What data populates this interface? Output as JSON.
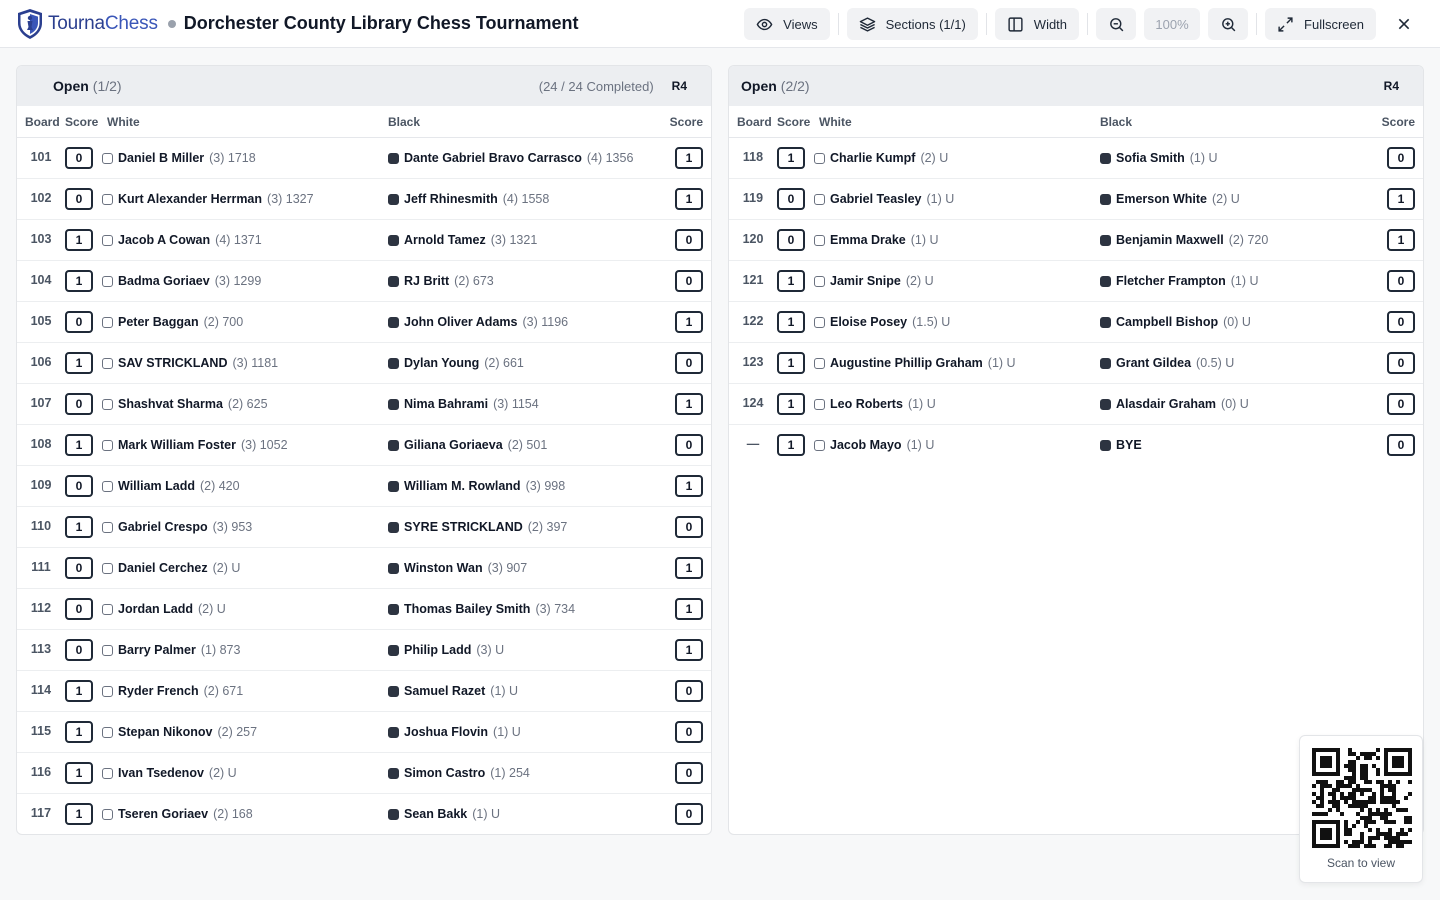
{
  "app": {
    "logo_text_a": "Tourna",
    "logo_text_b": "Chess",
    "title": "Dorchester County Library Chess Tournament"
  },
  "toolbar": {
    "views": "Views",
    "sections": "Sections (1/1)",
    "width": "Width",
    "zoom": "100%",
    "fullscreen": "Fullscreen"
  },
  "columns": {
    "board": "Board",
    "score": "Score",
    "white": "White",
    "black": "Black",
    "score_right": "Score"
  },
  "sections": [
    {
      "name": "Open",
      "count": "(1/2)",
      "completed": "(24 / 24 Completed)",
      "round": "R4",
      "rows": [
        {
          "board": "101",
          "ws": "0",
          "wn": "Daniel B Miller",
          "wm": "(3) 1718",
          "bn": "Dante Gabriel Bravo Carrasco",
          "bm": "(4) 1356",
          "bs": "1"
        },
        {
          "board": "102",
          "ws": "0",
          "wn": "Kurt Alexander Herrman",
          "wm": "(3) 1327",
          "bn": "Jeff Rhinesmith",
          "bm": "(4) 1558",
          "bs": "1"
        },
        {
          "board": "103",
          "ws": "1",
          "wn": "Jacob A Cowan",
          "wm": "(4) 1371",
          "bn": "Arnold Tamez",
          "bm": "(3) 1321",
          "bs": "0"
        },
        {
          "board": "104",
          "ws": "1",
          "wn": "Badma Goriaev",
          "wm": "(3) 1299",
          "bn": "RJ Britt",
          "bm": "(2) 673",
          "bs": "0"
        },
        {
          "board": "105",
          "ws": "0",
          "wn": "Peter Baggan",
          "wm": "(2) 700",
          "bn": "John Oliver Adams",
          "bm": "(3) 1196",
          "bs": "1"
        },
        {
          "board": "106",
          "ws": "1",
          "wn": "SAV STRICKLAND",
          "wm": "(3) 1181",
          "bn": "Dylan Young",
          "bm": "(2) 661",
          "bs": "0"
        },
        {
          "board": "107",
          "ws": "0",
          "wn": "Shashvat Sharma",
          "wm": "(2) 625",
          "bn": "Nima Bahrami",
          "bm": "(3) 1154",
          "bs": "1"
        },
        {
          "board": "108",
          "ws": "1",
          "wn": "Mark William Foster",
          "wm": "(3) 1052",
          "bn": "Giliana Goriaeva",
          "bm": "(2) 501",
          "bs": "0"
        },
        {
          "board": "109",
          "ws": "0",
          "wn": "William Ladd",
          "wm": "(2) 420",
          "bn": "William M. Rowland",
          "bm": "(3) 998",
          "bs": "1"
        },
        {
          "board": "110",
          "ws": "1",
          "wn": "Gabriel Crespo",
          "wm": "(3) 953",
          "bn": "SYRE STRICKLAND",
          "bm": "(2) 397",
          "bs": "0"
        },
        {
          "board": "111",
          "ws": "0",
          "wn": "Daniel Cerchez",
          "wm": "(2) U",
          "bn": "Winston Wan",
          "bm": "(3) 907",
          "bs": "1"
        },
        {
          "board": "112",
          "ws": "0",
          "wn": "Jordan Ladd",
          "wm": "(2) U",
          "bn": "Thomas Bailey Smith",
          "bm": "(3) 734",
          "bs": "1"
        },
        {
          "board": "113",
          "ws": "0",
          "wn": "Barry Palmer",
          "wm": "(1) 873",
          "bn": "Philip Ladd",
          "bm": "(3) U",
          "bs": "1"
        },
        {
          "board": "114",
          "ws": "1",
          "wn": "Ryder French",
          "wm": "(2) 671",
          "bn": "Samuel Razet",
          "bm": "(1) U",
          "bs": "0"
        },
        {
          "board": "115",
          "ws": "1",
          "wn": "Stepan Nikonov",
          "wm": "(2) 257",
          "bn": "Joshua Flovin",
          "bm": "(1) U",
          "bs": "0"
        },
        {
          "board": "116",
          "ws": "1",
          "wn": "Ivan Tsedenov",
          "wm": "(2) U",
          "bn": "Simon Castro",
          "bm": "(1) 254",
          "bs": "0"
        },
        {
          "board": "117",
          "ws": "1",
          "wn": "Tseren Goriaev",
          "wm": "(2) 168",
          "bn": "Sean Bakk",
          "bm": "(1) U",
          "bs": "0"
        }
      ]
    },
    {
      "name": "Open",
      "count": "(2/2)",
      "completed": "",
      "round": "R4",
      "rows": [
        {
          "board": "118",
          "ws": "1",
          "wn": "Charlie Kumpf",
          "wm": "(2) U",
          "bn": "Sofia Smith",
          "bm": "(1) U",
          "bs": "0"
        },
        {
          "board": "119",
          "ws": "0",
          "wn": "Gabriel Teasley",
          "wm": "(1) U",
          "bn": "Emerson White",
          "bm": "(2) U",
          "bs": "1"
        },
        {
          "board": "120",
          "ws": "0",
          "wn": "Emma Drake",
          "wm": "(1) U",
          "bn": "Benjamin Maxwell",
          "bm": "(2) 720",
          "bs": "1"
        },
        {
          "board": "121",
          "ws": "1",
          "wn": "Jamir Snipe",
          "wm": "(2) U",
          "bn": "Fletcher Frampton",
          "bm": "(1) U",
          "bs": "0"
        },
        {
          "board": "122",
          "ws": "1",
          "wn": "Eloise Posey",
          "wm": "(1.5) U",
          "bn": "Campbell Bishop",
          "bm": "(0) U",
          "bs": "0"
        },
        {
          "board": "123",
          "ws": "1",
          "wn": "Augustine Phillip Graham",
          "wm": "(1) U",
          "bn": "Grant Gildea",
          "bm": "(0.5) U",
          "bs": "0"
        },
        {
          "board": "124",
          "ws": "1",
          "wn": "Leo Roberts",
          "wm": "(1) U",
          "bn": "Alasdair Graham",
          "bm": "(0) U",
          "bs": "0"
        },
        {
          "board": "—",
          "ws": "1",
          "wn": "Jacob Mayo",
          "wm": "(1) U",
          "bn": "BYE",
          "bm": "",
          "bs": "0"
        }
      ]
    }
  ],
  "qr": {
    "caption": "Scan to view"
  },
  "icons": {
    "views": "eye-icon",
    "sections": "layers-icon",
    "width": "columns-icon",
    "zoom_out": "zoom-out-icon",
    "zoom_in": "zoom-in-icon",
    "fullscreen": "expand-icon",
    "close": "close-icon"
  }
}
